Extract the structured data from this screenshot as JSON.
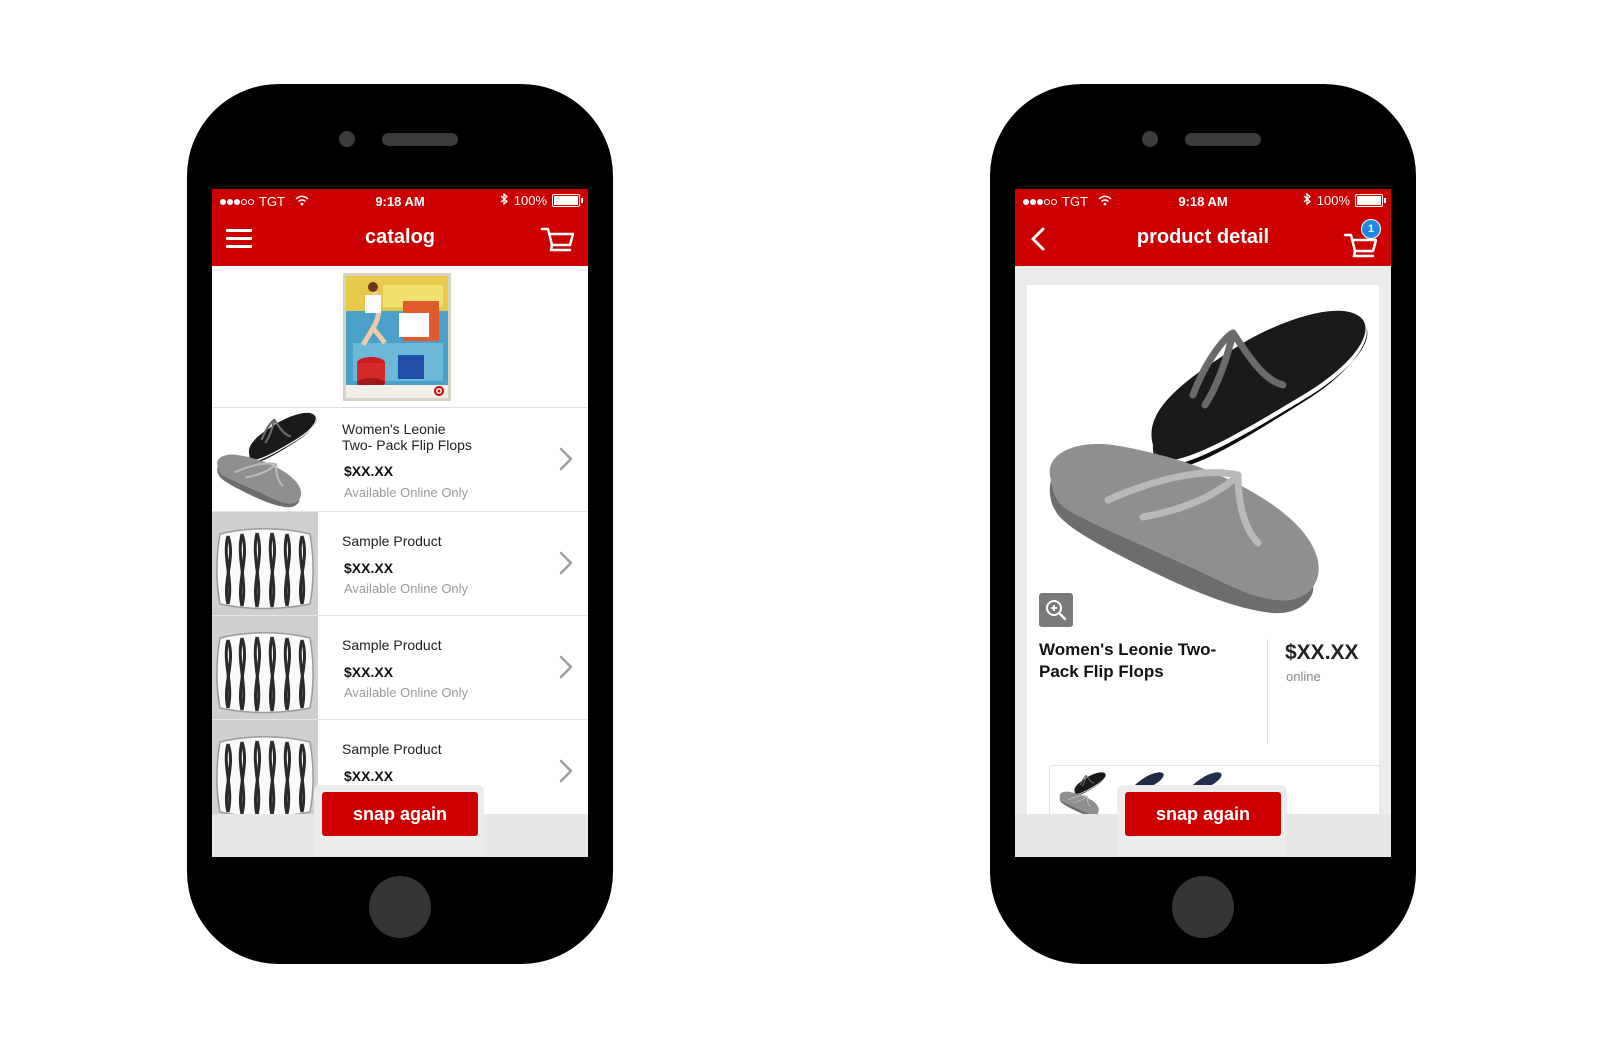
{
  "status_bar": {
    "carrier": "TGT",
    "time": "9:18 AM",
    "battery": "100%"
  },
  "catalog_screen": {
    "title": "catalog",
    "items": [
      {
        "name": "Women's Leonie\nTwo- Pack Flip Flops",
        "price": "$XX.XX",
        "availability": "Available Online Only"
      },
      {
        "name": "Sample Product",
        "price": "$XX.XX",
        "availability": "Available Online Only"
      },
      {
        "name": "Sample Product",
        "price": "$XX.XX",
        "availability": "Available Online Only"
      },
      {
        "name": "Sample Product",
        "price": "$XX.XX",
        "availability": ""
      }
    ],
    "snap_label": "snap again"
  },
  "detail_screen": {
    "title": "product detail",
    "cart_count": "1",
    "product_name": "Women's Leonie Two-Pack Flip Flops",
    "price": "$XX.XX",
    "availability": "online",
    "snap_label": "snap again"
  },
  "colors": {
    "brand_red": "#cc0000",
    "badge_blue": "#1e88e5"
  },
  "icons": [
    "menu-icon",
    "cart-icon",
    "back-icon",
    "chevron-right-icon",
    "zoom-in-icon",
    "wifi-icon",
    "bluetooth-icon",
    "battery-icon"
  ]
}
